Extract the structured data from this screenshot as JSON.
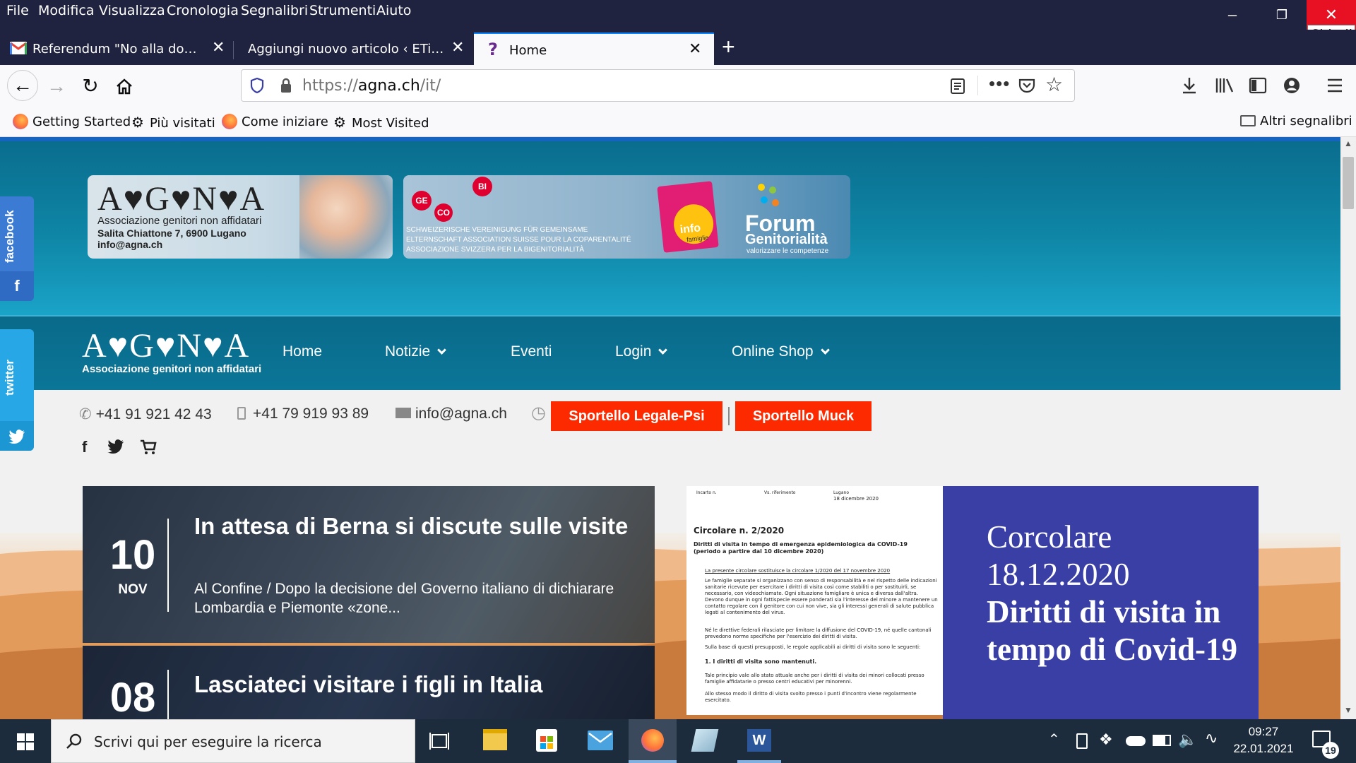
{
  "menubar": {
    "items": [
      "File",
      "Modifica",
      "Visualizza",
      "Cronologia",
      "Segnalibri",
      "Strumenti",
      "Aiuto"
    ],
    "close_tooltip": "Chiudi"
  },
  "tabs": [
    {
      "label": "Referendum \"No alla donazione",
      "icon": "gmail-icon"
    },
    {
      "label": "Aggiungi nuovo articolo ‹ ETiCinfor",
      "icon": "none"
    },
    {
      "label": "Home",
      "icon": "help-icon",
      "active": true
    }
  ],
  "navbar": {
    "url_scheme": "https://",
    "url_host": "agna.ch",
    "url_path": "/it/"
  },
  "bookmarks": {
    "items": [
      "Getting Started",
      "Più visitati",
      "Come iniziare",
      "Most Visited"
    ],
    "other": "Altri segnalibri"
  },
  "site": {
    "banner1": {
      "logo": "A♥G♥N♥A",
      "line1": "Associazione genitori non affidatari",
      "line2": "Salita Chiattone 7, 6900 Lugano",
      "line3": "info@agna.ch"
    },
    "banner2": {
      "ge": "GE",
      "co": "CO",
      "bi": "BI",
      "line1": "SCHWEIZERISCHE VEREINIGUNG FÜR GEMEINSAME",
      "line2": "ELTERNSCHAFT ASSOCIATION SUISSE POUR LA COPARENTALITÉ",
      "line3": "ASSOCIAZIONE SVIZZERA PER LA BIGENITORIALITÀ",
      "info": "info",
      "famiglie": "famiglie",
      "forum1": "Forum",
      "forum2": "Genitorialità",
      "forum3": "valorizzare le competenze"
    },
    "nav_logo": "A♥G♥N♥A",
    "nav_logo_sub": "Associazione genitori non affidatari",
    "nav": [
      "Home",
      "Notizie",
      "Eventi",
      "Login",
      "Online Shop"
    ],
    "contact": {
      "phone1": "+41 91 921 42 43",
      "phone2": "+41 79 919 93 89",
      "email": "info@agna.ch",
      "btn1": "Sportello Legale-Psi",
      "btn2": "Sportello Muck"
    },
    "social": {
      "facebook": "facebook",
      "twitter": "twitter"
    },
    "news": [
      {
        "day": "10",
        "month": "NOV",
        "title": "In attesa di Berna si discute sulle visite",
        "excerpt": "Al Confine / Dopo la decisione del Governo italiano di dichiarare Lombardia e Piemonte «zone..."
      },
      {
        "day": "08",
        "month": "",
        "title": "Lasciateci visitare i figli in Italia",
        "excerpt": ""
      }
    ],
    "doc": {
      "h1": "Incarto n.",
      "h2": "Vs. riferimento",
      "h3": "Lugano",
      "date": "18 dicembre 2020",
      "title": "Circolare n. 2/2020",
      "subtitle": "Diritti di visita in tempo di emergenza epidemiologica da COVID-19 (periodo a partire dal 10 dicembre 2020)",
      "replaces": "La presente circolare sostituisce la circolare 1/2020 del 17 novembre 2020",
      "para1": "Le famiglie separate si organizzano con senso di responsabilità e nel rispetto delle indicazioni sanitarie ricevute per esercitare i diritti di visita così come stabiliti o per sostituirli, se necessario, con videochiamate. Ogni situazione famigliare è unica e diversa dall'altra. Devono dunque in ogni fattispecie essere ponderati sia l'interesse del minore a mantenere un contatto regolare con il genitore con cui non vive, sia gli interessi generali di salute pubblica legati al contenimento del virus.",
      "para2": "Né le direttive federali rilasciate per limitare la diffusione del COVID-19, né quelle cantonali prevedono norme specifiche per l'esercizio dei diritti di visita.",
      "para3": "Sulla base di questi presupposti, le regole applicabili ai diritti di visita sono le seguenti:",
      "point1": "1.    I diritti di visita sono mantenuti.",
      "para4": "Tale principio vale allo stato attuale anche per i diritti di visita dei minori collocati presso famiglie affidatarie o presso centri educativi per minorenni.",
      "para5": "Allo stesso modo il diritto di visita svolto presso i punti d'incontro viene regolarmente esercitato."
    },
    "feature": {
      "line1": "Corcolare 18.12.2020",
      "line2": "Diritti di visita in tempo di Covid-19"
    }
  },
  "taskbar": {
    "search_placeholder": "Scrivi qui per eseguire la ricerca",
    "time": "09:27",
    "date": "22.01.2021",
    "notif": "19"
  }
}
